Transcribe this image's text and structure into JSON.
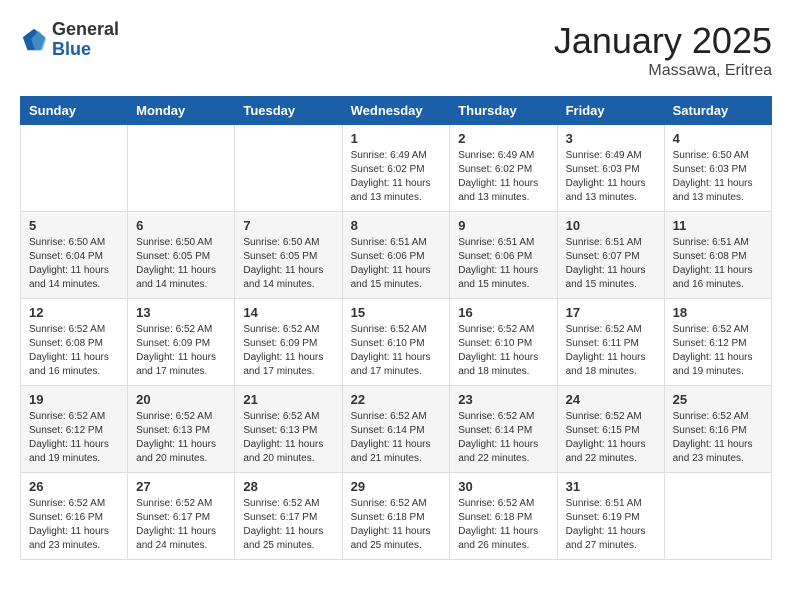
{
  "logo": {
    "general": "General",
    "blue": "Blue"
  },
  "title": {
    "month": "January 2025",
    "location": "Massawa, Eritrea"
  },
  "days": [
    "Sunday",
    "Monday",
    "Tuesday",
    "Wednesday",
    "Thursday",
    "Friday",
    "Saturday"
  ],
  "weeks": [
    [
      {
        "day": "",
        "content": ""
      },
      {
        "day": "",
        "content": ""
      },
      {
        "day": "",
        "content": ""
      },
      {
        "day": "1",
        "content": "Sunrise: 6:49 AM\nSunset: 6:02 PM\nDaylight: 11 hours\nand 13 minutes."
      },
      {
        "day": "2",
        "content": "Sunrise: 6:49 AM\nSunset: 6:02 PM\nDaylight: 11 hours\nand 13 minutes."
      },
      {
        "day": "3",
        "content": "Sunrise: 6:49 AM\nSunset: 6:03 PM\nDaylight: 11 hours\nand 13 minutes."
      },
      {
        "day": "4",
        "content": "Sunrise: 6:50 AM\nSunset: 6:03 PM\nDaylight: 11 hours\nand 13 minutes."
      }
    ],
    [
      {
        "day": "5",
        "content": "Sunrise: 6:50 AM\nSunset: 6:04 PM\nDaylight: 11 hours\nand 14 minutes."
      },
      {
        "day": "6",
        "content": "Sunrise: 6:50 AM\nSunset: 6:05 PM\nDaylight: 11 hours\nand 14 minutes."
      },
      {
        "day": "7",
        "content": "Sunrise: 6:50 AM\nSunset: 6:05 PM\nDaylight: 11 hours\nand 14 minutes."
      },
      {
        "day": "8",
        "content": "Sunrise: 6:51 AM\nSunset: 6:06 PM\nDaylight: 11 hours\nand 15 minutes."
      },
      {
        "day": "9",
        "content": "Sunrise: 6:51 AM\nSunset: 6:06 PM\nDaylight: 11 hours\nand 15 minutes."
      },
      {
        "day": "10",
        "content": "Sunrise: 6:51 AM\nSunset: 6:07 PM\nDaylight: 11 hours\nand 15 minutes."
      },
      {
        "day": "11",
        "content": "Sunrise: 6:51 AM\nSunset: 6:08 PM\nDaylight: 11 hours\nand 16 minutes."
      }
    ],
    [
      {
        "day": "12",
        "content": "Sunrise: 6:52 AM\nSunset: 6:08 PM\nDaylight: 11 hours\nand 16 minutes."
      },
      {
        "day": "13",
        "content": "Sunrise: 6:52 AM\nSunset: 6:09 PM\nDaylight: 11 hours\nand 17 minutes."
      },
      {
        "day": "14",
        "content": "Sunrise: 6:52 AM\nSunset: 6:09 PM\nDaylight: 11 hours\nand 17 minutes."
      },
      {
        "day": "15",
        "content": "Sunrise: 6:52 AM\nSunset: 6:10 PM\nDaylight: 11 hours\nand 17 minutes."
      },
      {
        "day": "16",
        "content": "Sunrise: 6:52 AM\nSunset: 6:10 PM\nDaylight: 11 hours\nand 18 minutes."
      },
      {
        "day": "17",
        "content": "Sunrise: 6:52 AM\nSunset: 6:11 PM\nDaylight: 11 hours\nand 18 minutes."
      },
      {
        "day": "18",
        "content": "Sunrise: 6:52 AM\nSunset: 6:12 PM\nDaylight: 11 hours\nand 19 minutes."
      }
    ],
    [
      {
        "day": "19",
        "content": "Sunrise: 6:52 AM\nSunset: 6:12 PM\nDaylight: 11 hours\nand 19 minutes."
      },
      {
        "day": "20",
        "content": "Sunrise: 6:52 AM\nSunset: 6:13 PM\nDaylight: 11 hours\nand 20 minutes."
      },
      {
        "day": "21",
        "content": "Sunrise: 6:52 AM\nSunset: 6:13 PM\nDaylight: 11 hours\nand 20 minutes."
      },
      {
        "day": "22",
        "content": "Sunrise: 6:52 AM\nSunset: 6:14 PM\nDaylight: 11 hours\nand 21 minutes."
      },
      {
        "day": "23",
        "content": "Sunrise: 6:52 AM\nSunset: 6:14 PM\nDaylight: 11 hours\nand 22 minutes."
      },
      {
        "day": "24",
        "content": "Sunrise: 6:52 AM\nSunset: 6:15 PM\nDaylight: 11 hours\nand 22 minutes."
      },
      {
        "day": "25",
        "content": "Sunrise: 6:52 AM\nSunset: 6:16 PM\nDaylight: 11 hours\nand 23 minutes."
      }
    ],
    [
      {
        "day": "26",
        "content": "Sunrise: 6:52 AM\nSunset: 6:16 PM\nDaylight: 11 hours\nand 23 minutes."
      },
      {
        "day": "27",
        "content": "Sunrise: 6:52 AM\nSunset: 6:17 PM\nDaylight: 11 hours\nand 24 minutes."
      },
      {
        "day": "28",
        "content": "Sunrise: 6:52 AM\nSunset: 6:17 PM\nDaylight: 11 hours\nand 25 minutes."
      },
      {
        "day": "29",
        "content": "Sunrise: 6:52 AM\nSunset: 6:18 PM\nDaylight: 11 hours\nand 25 minutes."
      },
      {
        "day": "30",
        "content": "Sunrise: 6:52 AM\nSunset: 6:18 PM\nDaylight: 11 hours\nand 26 minutes."
      },
      {
        "day": "31",
        "content": "Sunrise: 6:51 AM\nSunset: 6:19 PM\nDaylight: 11 hours\nand 27 minutes."
      },
      {
        "day": "",
        "content": ""
      }
    ]
  ]
}
